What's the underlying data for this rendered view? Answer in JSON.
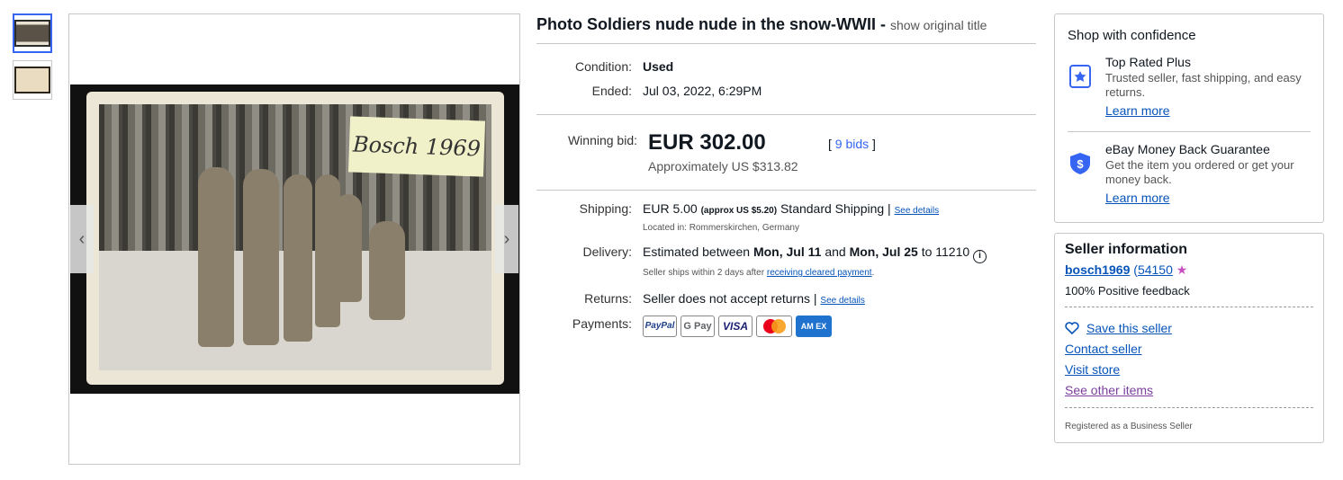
{
  "thumbnails": [
    {
      "alt": "thumbnail-1",
      "active": true
    },
    {
      "alt": "thumbnail-2",
      "active": false
    }
  ],
  "image": {
    "label_text": "Bosch 1969"
  },
  "listing": {
    "title": "Photo Soldiers nude nude in the snow-WWII -",
    "show_original": "show original title",
    "condition_label": "Condition:",
    "condition_value": "Used",
    "ended_label": "Ended:",
    "ended_value": "Jul 03, 2022, 6:29PM",
    "winning_bid_label": "Winning bid:",
    "winning_bid_value": "EUR 302.00",
    "bids_open": "[",
    "bids_link": "9 bids",
    "bids_close": "]",
    "approx_value": "Approximately US $313.82",
    "shipping_label": "Shipping:",
    "shipping_price": "EUR 5.00",
    "shipping_approx": "(approx US $5.20)",
    "shipping_service": "Standard Shipping |",
    "shipping_details_link": "See details",
    "located_in": "Located in: Rommerskirchen, Germany",
    "delivery_label": "Delivery:",
    "delivery_prefix": "Estimated between",
    "delivery_start": "Mon, Jul 11",
    "delivery_and": "and",
    "delivery_end": "Mon, Jul 25",
    "delivery_to": "to 11210",
    "delivery_note_prefix": "Seller ships within 2 days after",
    "delivery_note_link": "receiving cleared payment",
    "delivery_note_suffix": ".",
    "returns_label": "Returns:",
    "returns_value": "Seller does not accept returns |",
    "returns_details_link": "See details",
    "payments_label": "Payments:",
    "payments": {
      "paypal": "PayPal",
      "gpay": "G Pay",
      "visa": "VISA",
      "amex": "AM EX"
    }
  },
  "shop_confidence": {
    "title": "Shop with confidence",
    "items": [
      {
        "heading": "Top Rated Plus",
        "text": "Trusted seller, fast shipping, and easy returns.",
        "link": "Learn more"
      },
      {
        "heading": "eBay Money Back Guarantee",
        "text": "Get the item you ordered or get your money back.",
        "link": "Learn more"
      }
    ]
  },
  "seller_info": {
    "title": "Seller information",
    "username": "bosch1969",
    "feedback_open": "(",
    "feedback_count": "54150",
    "positive": "100% Positive feedback",
    "save_seller": "Save this seller",
    "contact_seller": "Contact seller",
    "visit_store": "Visit store",
    "other_items": "See other items",
    "business": "Registered as a Business Seller"
  },
  "colors": {
    "link": "#0654ba",
    "accent": "#3665f3",
    "visited": "#7b3f9e"
  }
}
